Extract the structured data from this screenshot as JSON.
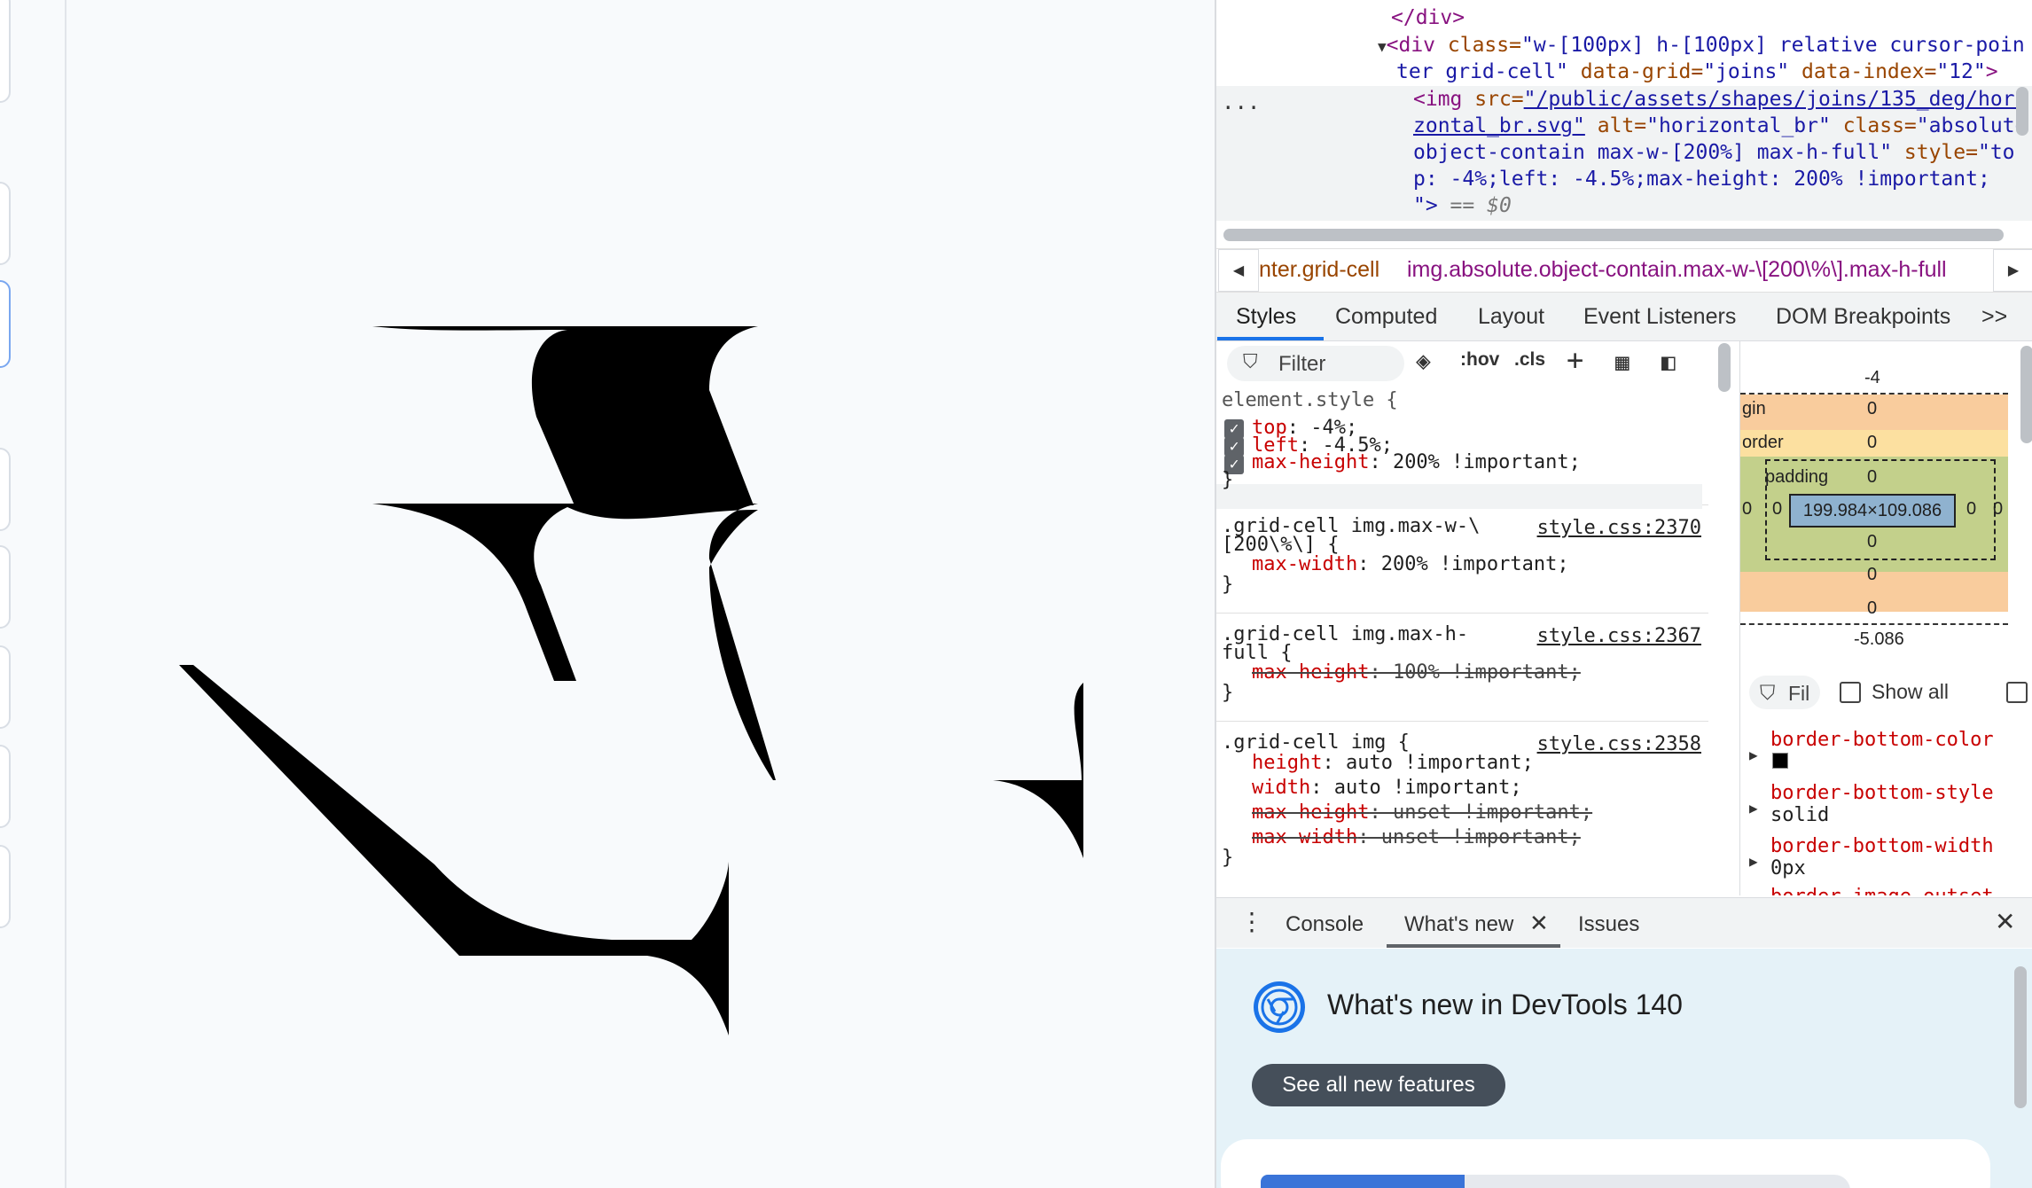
{
  "devtools": {
    "dom_tree": {
      "close_div": "</div>",
      "div_line1_tag": "<div ",
      "div_line1_attr": "class=",
      "div_line1_val": "\"w-[100px] h-[100px] relative cursor-poin",
      "div_line2_val": "ter grid-cell\"",
      "div_line2_attr1": " data-grid=",
      "div_line2_val1": "\"joins\"",
      "div_line2_attr2": " data-index=",
      "div_line2_val2": "\"12\"",
      "div_line2_end": ">",
      "img_line1_tag": "<img ",
      "img_line1_attr": "src=",
      "img_line1_val": "\"/public/assets/shapes/joins/135_deg/hori",
      "img_line2_val": "zontal_br.svg\"",
      "img_line2_attr1": " alt=",
      "img_line2_val1": "\"horizontal_br\"",
      "img_line2_attr2": " class=",
      "img_line2_val2": "\"absolute",
      "img_line3_val": "object-contain max-w-[200%] max-h-full\"",
      "img_line3_attr": " style=",
      "img_line3_val2": "\"to",
      "img_line4_val": "p: -4%;left: -4.5%;max-height: 200% !important;",
      "img_line5_val": "\">",
      "img_line5_eq": " == $0",
      "ellipsis": "..."
    },
    "breadcrumbs": {
      "left_item": "nter.grid-cell",
      "right_item": "img.absolute.object-contain.max-w-\\[200\\%\\].max-h-full"
    },
    "panel_tabs": [
      "Styles",
      "Computed",
      "Layout",
      "Event Listeners",
      "DOM Breakpoints",
      ">>"
    ],
    "styles_toolbar": {
      "filter_placeholder": "Filter",
      "hov": ":hov",
      "cls": ".cls",
      "plus": "+"
    },
    "styles": {
      "element_style": "element.style {",
      "es_top_prop": "top",
      "es_top_val": ": -4%;",
      "es_left_prop": "left",
      "es_left_val": ": -4.5%;",
      "es_mh_prop": "max-height",
      "es_mh_val": ": 200% !important;",
      "close": "}",
      "r1_sel1": ".grid-cell img.max-w-\\",
      "r1_sel2": "[200\\%\\] {",
      "r1_src": "style.css:2370",
      "r1_prop": "max-width",
      "r1_val": ": 200% !important;",
      "r2_sel1": ".grid-cell img.max-h-",
      "r2_sel2": "full {",
      "r2_src": "style.css:2367",
      "r2_prop": "max-height",
      "r2_val": ": 100% !important;",
      "r3_sel": ".grid-cell img {",
      "r3_src": "style.css:2358",
      "r3_p1": "height",
      "r3_v1": ": auto !important;",
      "r3_p2": "width",
      "r3_v2": ": auto !important;",
      "r3_p3": "max-height",
      "r3_v3": ": unset !important;",
      "r3_p4": "max-width",
      "r3_v4": ": unset !important;"
    },
    "box_model": {
      "top_position": "-4",
      "margin_label": "gin",
      "margin_top": "0",
      "border_label": "order",
      "border_top": "0",
      "padding_label": "padding",
      "padding_top": "0",
      "padding_left": "0",
      "padding_right": "0",
      "border_left": "0",
      "border_right": "0",
      "content_size": "199.984×109.086",
      "padding_bottom": "0",
      "border_bottom": "0",
      "margin_bottom": "0",
      "bottom_position": "-5.086"
    },
    "computed": {
      "filter": "Fil",
      "show_all": "Show all",
      "props": [
        {
          "name": "border-bottom-color",
          "value": ""
        },
        {
          "name": "border-bottom-style",
          "value": "solid"
        },
        {
          "name": "border-bottom-width",
          "value": "0px"
        },
        {
          "name": "border-image-outset",
          "value": ""
        }
      ]
    },
    "drawer": {
      "tabs": [
        "Console",
        "What's new",
        "Issues"
      ],
      "whats_new_title": "What's new in DevTools 140",
      "see_features": "See all new features"
    }
  }
}
